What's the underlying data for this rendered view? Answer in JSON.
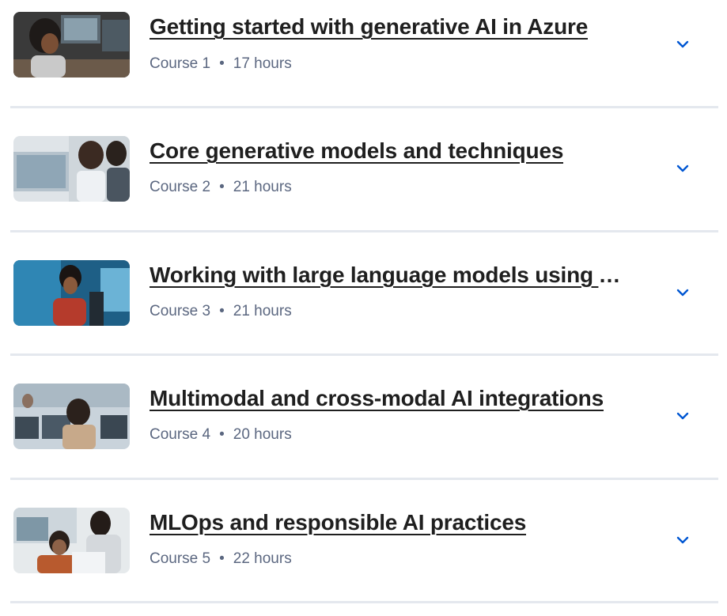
{
  "accent_color": "#0056d2",
  "courses": [
    {
      "title": "Getting started with generative AI in Azure",
      "course_label": "Course 1",
      "duration": "17 hours",
      "expand_icon": "chevron-down-icon"
    },
    {
      "title": "Core generative models and techniques",
      "course_label": "Course 2",
      "duration": "21 hours",
      "expand_icon": "chevron-down-icon"
    },
    {
      "title": "Working with large language models using Azure",
      "course_label": "Course 3",
      "duration": "21 hours",
      "expand_icon": "chevron-down-icon"
    },
    {
      "title": "Multimodal and cross-modal AI integrations",
      "course_label": "Course 4",
      "duration": "20 hours",
      "expand_icon": "chevron-down-icon"
    },
    {
      "title": "MLOps and responsible AI practices",
      "course_label": "Course 5",
      "duration": "22 hours",
      "expand_icon": "chevron-down-icon"
    }
  ]
}
